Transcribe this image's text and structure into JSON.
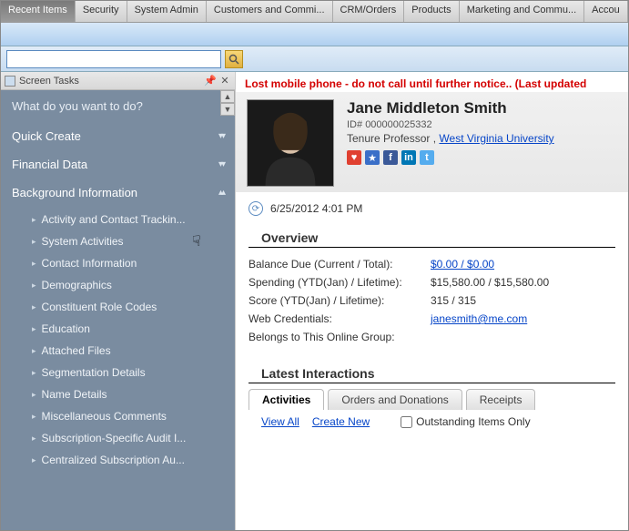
{
  "tabs": [
    "Recent Items",
    "Security",
    "System Admin",
    "Customers and Commi...",
    "CRM/Orders",
    "Products",
    "Marketing and Commu...",
    "Accou"
  ],
  "activeTab": 0,
  "sidebar": {
    "title": "Screen Tasks",
    "prompt": "What do you want to do?",
    "sections": [
      {
        "label": "Quick Create",
        "expanded": false
      },
      {
        "label": "Financial Data",
        "expanded": false
      },
      {
        "label": "Background Information",
        "expanded": true,
        "items": [
          "Activity and Contact Trackin...",
          "System Activities",
          "Contact Information",
          "Demographics",
          "Constituent Role Codes",
          "Education",
          "Attached Files",
          "Segmentation Details",
          "Name Details",
          "Miscellaneous Comments",
          "Subscription-Specific Audit I...",
          "Centralized Subscription Au..."
        ]
      }
    ]
  },
  "alert": "Lost mobile phone - do not call until further notice.. (Last updated",
  "person": {
    "name": "Jane Middleton Smith",
    "idLabel": "ID#",
    "id": "000000025332",
    "role": "Tenure Professor",
    "sep": ",",
    "org": "West Virginia University"
  },
  "timestamp": "6/25/2012 4:01 PM",
  "overview": {
    "heading": "Overview",
    "rows": [
      {
        "k": "Balance Due (Current / Total):",
        "v": "$0.00 / $0.00",
        "link": true
      },
      {
        "k": "Spending (YTD(Jan) / Lifetime):",
        "v": "$15,580.00 / $15,580.00",
        "link": false
      },
      {
        "k": "Score (YTD(Jan) / Lifetime):",
        "v": "315 / 315",
        "link": false
      },
      {
        "k": "Web Credentials:",
        "v": "janesmith@me.com",
        "link": true
      },
      {
        "k": "Belongs to This Online Group:",
        "v": "",
        "link": false
      }
    ]
  },
  "interactions": {
    "heading": "Latest Interactions",
    "tabs": [
      "Activities",
      "Orders and Donations",
      "Receipts"
    ],
    "active": 0,
    "viewAll": "View All",
    "createNew": "Create New",
    "outstanding": "Outstanding Items Only"
  }
}
